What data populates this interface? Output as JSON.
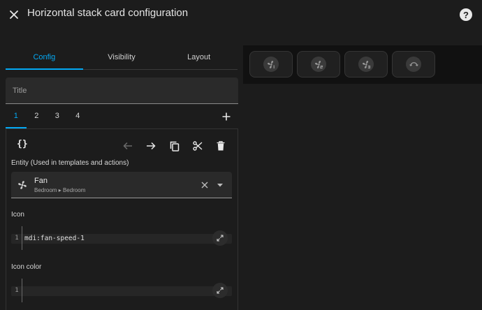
{
  "header": {
    "title": "Horizontal stack card configuration",
    "close_icon": "close-icon",
    "help_icon": "help-circle-icon",
    "help_glyph": "?"
  },
  "tabs": [
    {
      "label": "Config",
      "active": true
    },
    {
      "label": "Visibility",
      "active": false
    },
    {
      "label": "Layout",
      "active": false
    }
  ],
  "title_field": {
    "placeholder": "Title",
    "value": ""
  },
  "card_tabs": [
    {
      "label": "1",
      "active": true
    },
    {
      "label": "2",
      "active": false
    },
    {
      "label": "3",
      "active": false
    },
    {
      "label": "4",
      "active": false
    }
  ],
  "toolbar": {
    "yaml_toggle_label": "{}",
    "icons": [
      "arrow-left-icon",
      "arrow-right-icon",
      "copy-icon",
      "cut-icon",
      "delete-icon"
    ]
  },
  "entity_field": {
    "label": "Entity (Used in templates and actions)",
    "name": "Fan",
    "area": "Bedroom",
    "floor": "Bedroom",
    "separator": "▸",
    "icon": "fan-icon"
  },
  "icon_field": {
    "label": "Icon",
    "line_number": "1",
    "value": "mdi:fan-speed-1"
  },
  "icon_color_field": {
    "label": "Icon color",
    "line_number": "1",
    "value": ""
  },
  "preview": {
    "buttons": [
      {
        "icon": "fan-speed-1-icon"
      },
      {
        "icon": "fan-speed-2-icon"
      },
      {
        "icon": "fan-speed-3-icon"
      },
      {
        "icon": "fan-auto-icon"
      }
    ]
  },
  "colors": {
    "accent": "#03a9f4",
    "background": "#1c1c1c",
    "preview_background": "#111111"
  }
}
